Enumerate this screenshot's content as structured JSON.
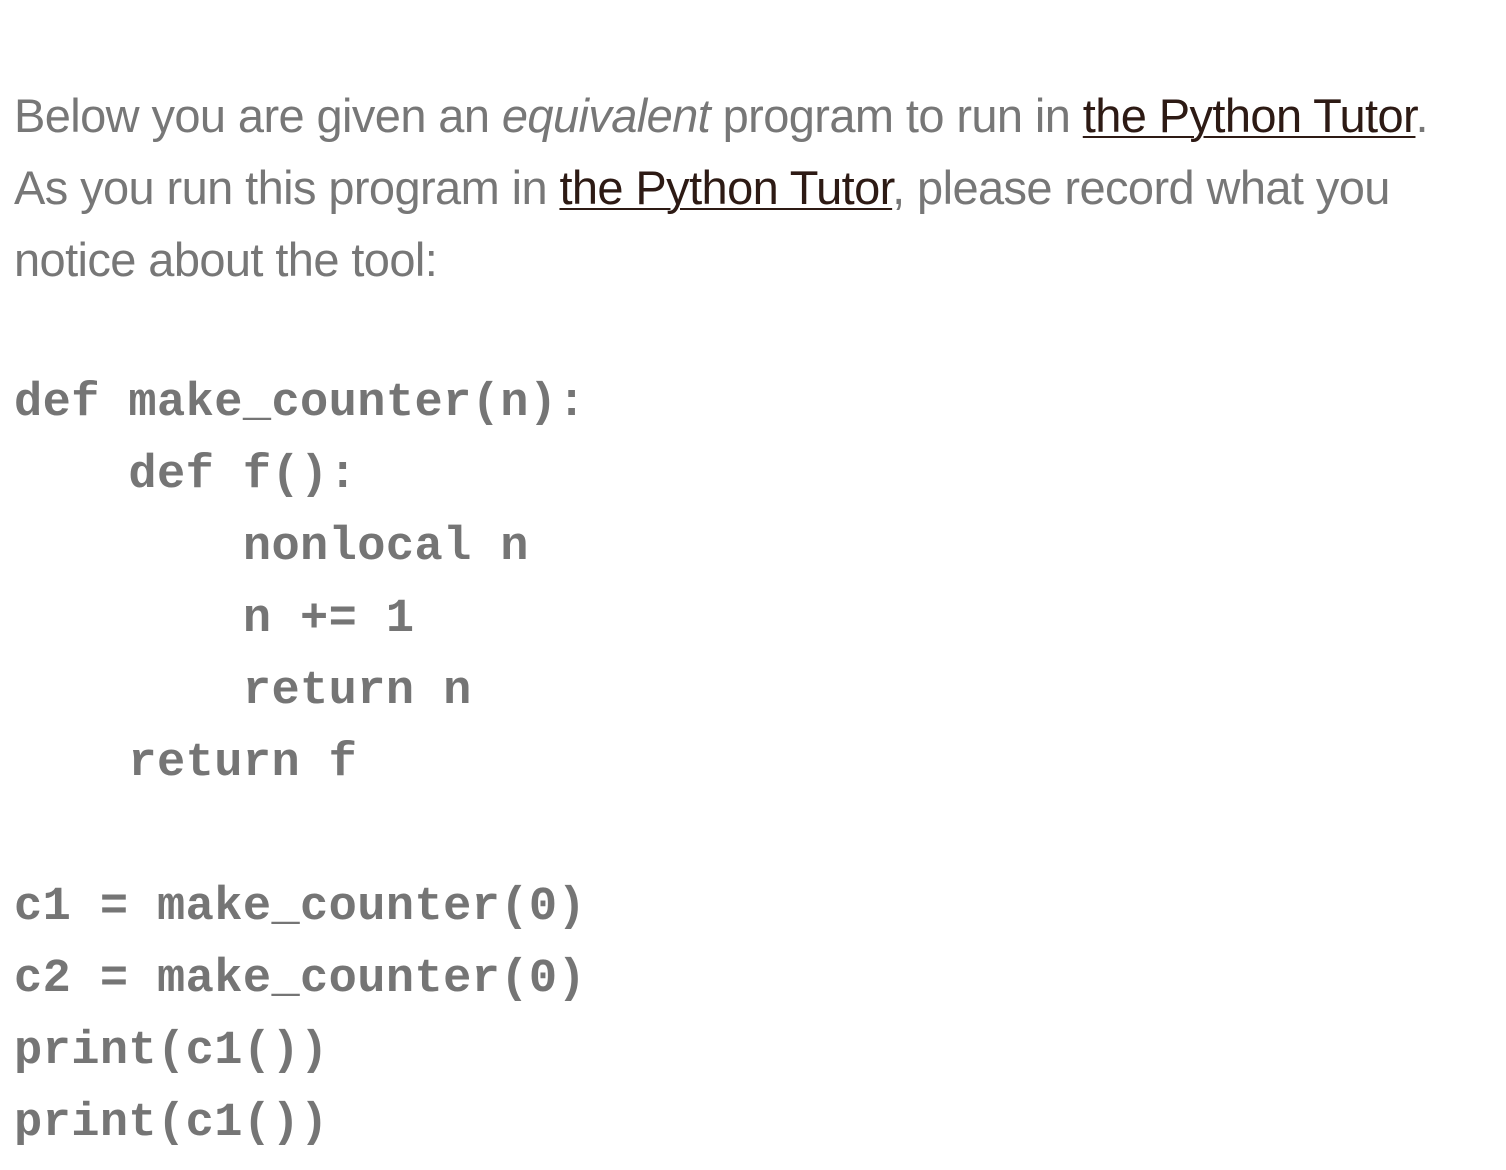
{
  "intro": {
    "line1_before": "Below you are given an ",
    "line1_em": "equivalent",
    "line1_middle": " program to run in ",
    "link1_text": "the Python Tutor",
    "line1_end": ".",
    "line2_before": "As you run this program in ",
    "link2_text": "the Python Tutor",
    "line2_after": ", please record what you",
    "line3": "notice about the tool:"
  },
  "code": {
    "lines": [
      "def make_counter(n):",
      "    def f():",
      "        nonlocal n",
      "        n += 1",
      "        return n",
      "    return f",
      "",
      "c1 = make_counter(0)",
      "c2 = make_counter(0)",
      "print(c1())",
      "print(c1())"
    ]
  }
}
